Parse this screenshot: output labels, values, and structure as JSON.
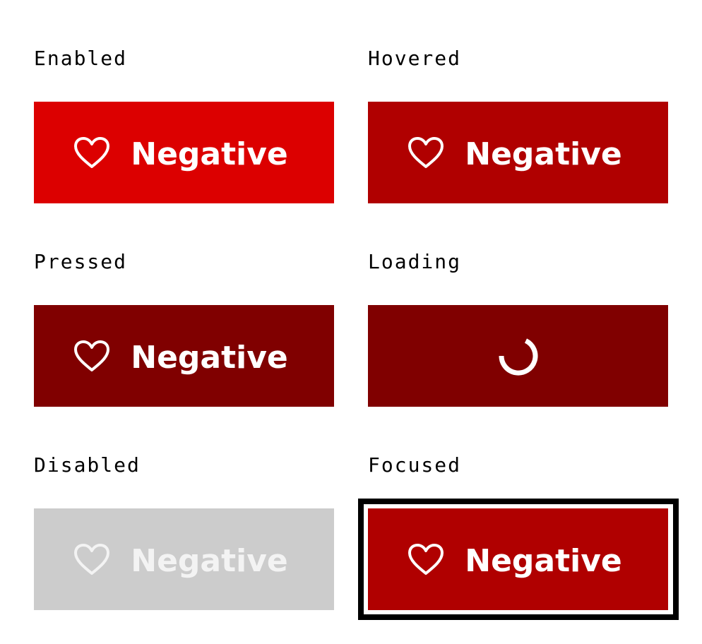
{
  "states": {
    "enabled": {
      "label": "Enabled",
      "button_text": "Negative",
      "bg": "#dc0000"
    },
    "hovered": {
      "label": "Hovered",
      "button_text": "Negative",
      "bg": "#b00000"
    },
    "pressed": {
      "label": "Pressed",
      "button_text": "Negative",
      "bg": "#800000"
    },
    "loading": {
      "label": "Loading",
      "bg": "#800000"
    },
    "disabled": {
      "label": "Disabled",
      "button_text": "Negative",
      "bg": "#cccccc"
    },
    "focused": {
      "label": "Focused",
      "button_text": "Negative",
      "bg": "#b00000",
      "ring": "#000000"
    }
  },
  "icons": {
    "button_icon": "heart-outline-icon",
    "loading_icon": "spinner-icon"
  }
}
